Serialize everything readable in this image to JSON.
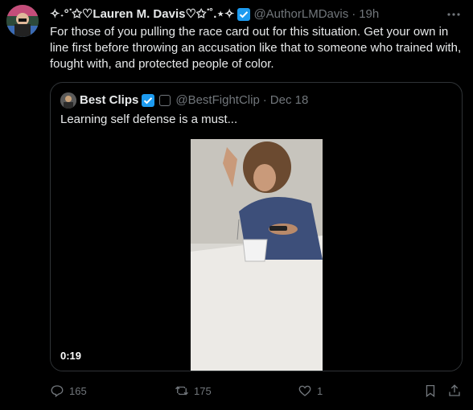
{
  "tweet": {
    "display_name": "✧˖°ᐝ✩♡Lauren M. Davis♡✩ᐝ˚.⋆✧",
    "handle": "@AuthorLMDavis",
    "separator": "·",
    "time": "19h",
    "text": "For those of you pulling the race card out for this situation. Get your own in line first before throwing an accusation like that to someone who trained with, fought with, and protected people of color."
  },
  "quote": {
    "display_name": "Best Clips",
    "handle": "@BestFightClip",
    "separator": "·",
    "date": "Dec 18",
    "text": "Learning self defense is a must...",
    "video_duration": "0:19"
  },
  "actions": {
    "replies": "165",
    "retweets": "175",
    "likes": "1"
  },
  "colors": {
    "background": "#000000",
    "text_primary": "#e7e9ea",
    "text_secondary": "#71767b",
    "verified_blue": "#1d9bf0",
    "border": "#2f3336"
  },
  "icons": [
    "more-icon",
    "verified-icon",
    "reply-icon",
    "retweet-icon",
    "like-icon",
    "bookmark-icon",
    "share-icon"
  ]
}
